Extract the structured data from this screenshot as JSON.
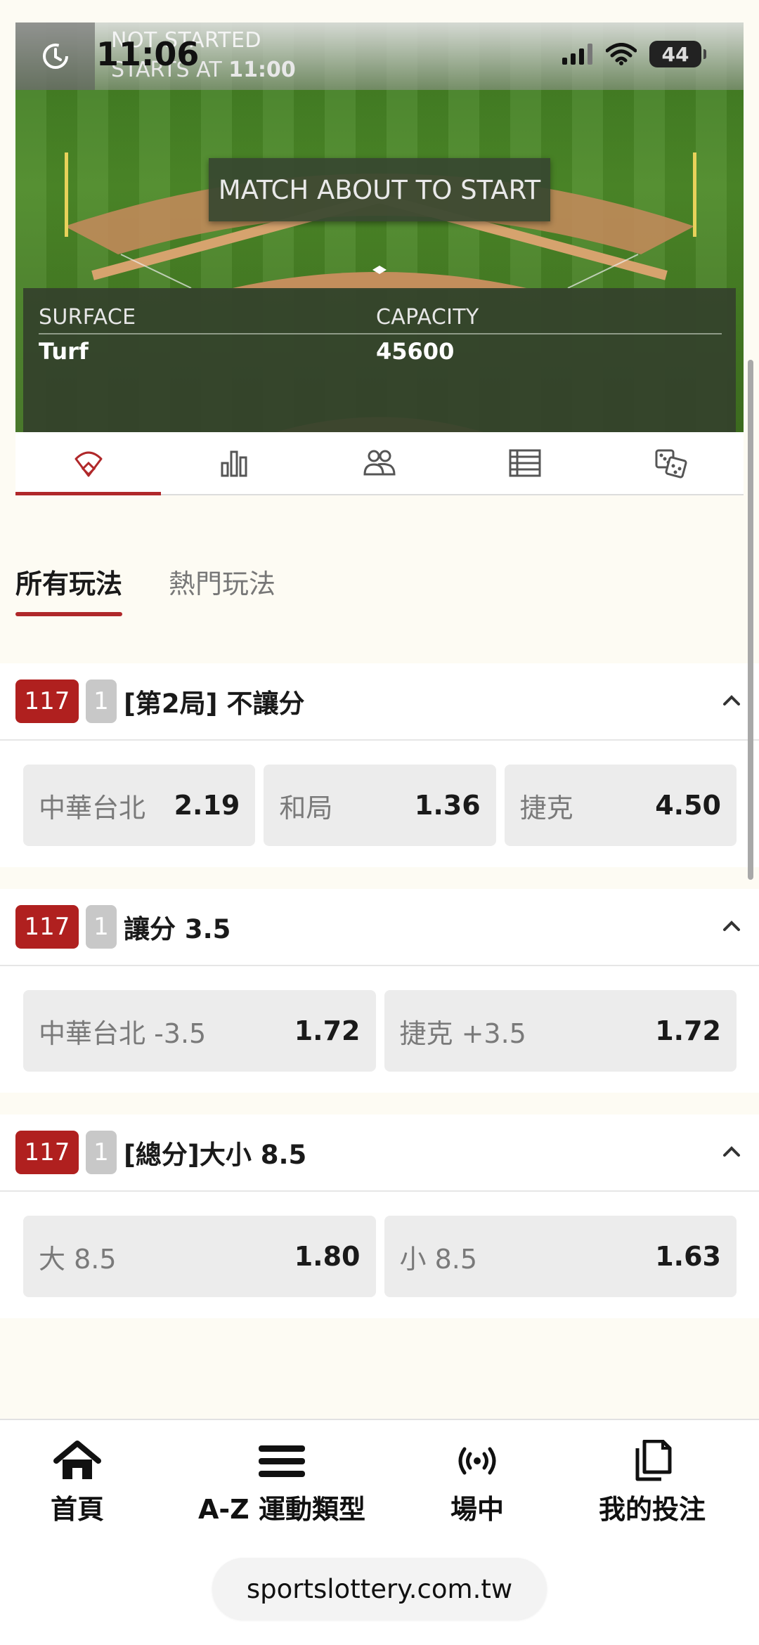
{
  "status_bar": {
    "time": "11:06",
    "battery": "44",
    "icons": [
      "clock-icon",
      "signal-icon",
      "wifi-icon",
      "battery-icon"
    ]
  },
  "match": {
    "state": "NOT STARTED",
    "starts_label": "STARTS AT",
    "starts_time": "11:00",
    "banner": "MATCH ABOUT TO START",
    "surface_label": "SURFACE",
    "surface_value": "Turf",
    "capacity_label": "CAPACITY",
    "capacity_value": "45600"
  },
  "icon_tabs": [
    {
      "icon": "baseball-field-icon",
      "active": true
    },
    {
      "icon": "bar-chart-icon",
      "active": false
    },
    {
      "icon": "players-icon",
      "active": false
    },
    {
      "icon": "lineup-list-icon",
      "active": false
    },
    {
      "icon": "dice-icon",
      "active": false
    }
  ],
  "market_tabs": [
    {
      "label": "所有玩法",
      "active": true
    },
    {
      "label": "熱門玩法",
      "active": false
    }
  ],
  "markets": [
    {
      "code": "117",
      "period": "1",
      "title": "[第2局] 不讓分",
      "odds": [
        {
          "selection": "中華台北",
          "price": "2.19"
        },
        {
          "selection": "和局",
          "price": "1.36"
        },
        {
          "selection": "捷克",
          "price": "4.50"
        }
      ]
    },
    {
      "code": "117",
      "period": "1",
      "title": "讓分 3.5",
      "odds": [
        {
          "selection": "中華台北 -3.5",
          "price": "1.72"
        },
        {
          "selection": "捷克 +3.5",
          "price": "1.72"
        }
      ]
    },
    {
      "code": "117",
      "period": "1",
      "title": "[總分]大小 8.5",
      "odds": [
        {
          "selection": "大 8.5",
          "price": "1.80"
        },
        {
          "selection": "小 8.5",
          "price": "1.63"
        }
      ]
    }
  ],
  "bottom_nav": [
    {
      "label": "首頁",
      "icon": "home-icon"
    },
    {
      "label": "A-Z 運動類型",
      "icon": "menu-icon"
    },
    {
      "label": "場中",
      "icon": "live-broadcast-icon"
    },
    {
      "label": "我的投注",
      "icon": "bets-icon"
    }
  ],
  "browser": {
    "url": "sportslottery.com.tw"
  },
  "colors": {
    "accent": "#b0282a",
    "badge_red": "#b0201f",
    "badge_grey": "#c8c8c8",
    "odds_bg": "#ececec",
    "field_green": "#4d8a28"
  }
}
